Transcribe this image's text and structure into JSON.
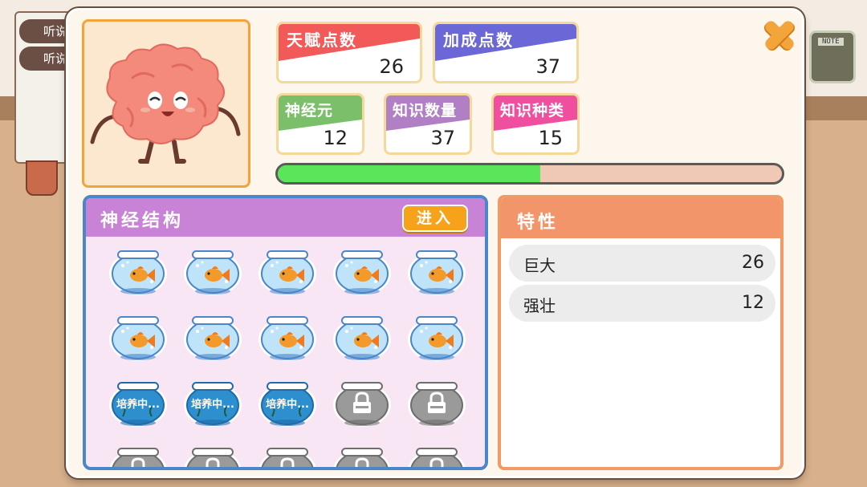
{
  "background": {
    "left_tabs": [
      "听说",
      "听说"
    ],
    "note_label": "NOTE"
  },
  "stats": {
    "talent": {
      "label": "天赋点数",
      "value": "26",
      "color": "#f25a5a"
    },
    "bonus": {
      "label": "加成点数",
      "value": "37",
      "color": "#6b67d6"
    },
    "neuron": {
      "label": "神经元",
      "value": "12",
      "color": "#7cbf6a"
    },
    "knowledge_count": {
      "label": "知识数量",
      "value": "37",
      "color": "#b07fc4"
    },
    "knowledge_kinds": {
      "label": "知识种类",
      "value": "15",
      "color": "#ef4f9e"
    }
  },
  "progress": {
    "fraction": 0.52,
    "fill_color": "#5ae55a"
  },
  "neural": {
    "title": "神经结构",
    "enter_label": "进入",
    "slots": [
      {
        "state": "fish"
      },
      {
        "state": "fish"
      },
      {
        "state": "fish"
      },
      {
        "state": "fish"
      },
      {
        "state": "fish"
      },
      {
        "state": "fish"
      },
      {
        "state": "fish"
      },
      {
        "state": "fish"
      },
      {
        "state": "fish"
      },
      {
        "state": "fish"
      },
      {
        "state": "training",
        "label": "培养中..."
      },
      {
        "state": "training",
        "label": "培养中..."
      },
      {
        "state": "training",
        "label": "培养中..."
      },
      {
        "state": "locked"
      },
      {
        "state": "locked"
      },
      {
        "state": "locked"
      },
      {
        "state": "locked"
      },
      {
        "state": "locked"
      },
      {
        "state": "locked"
      },
      {
        "state": "locked"
      }
    ]
  },
  "traits": {
    "title": "特性",
    "items": [
      {
        "name": "巨大",
        "value": "26"
      },
      {
        "name": "强壮",
        "value": "12"
      }
    ]
  },
  "icons": {
    "close": "close-icon",
    "brain": "brain-character-icon",
    "bowl": "fishbowl-icon",
    "lock": "lock-icon"
  }
}
